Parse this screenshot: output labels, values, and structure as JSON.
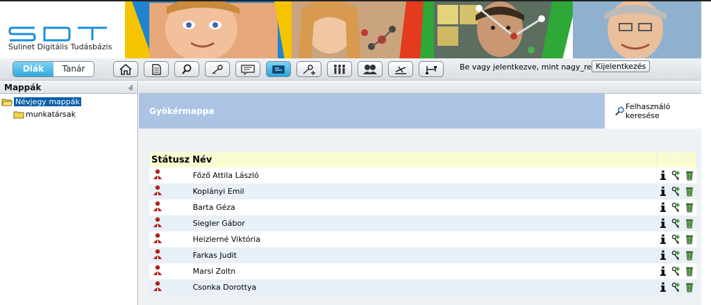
{
  "header": {
    "logo_mark": "SDT",
    "logo_tagline": "Sulinet Digitális Tudásbázis"
  },
  "toolbar": {
    "roles": [
      {
        "label": "Diák",
        "active": true
      },
      {
        "label": "Tanár",
        "active": false
      }
    ],
    "buttons": [
      {
        "icon": "home-icon",
        "active": false
      },
      {
        "icon": "document-icon",
        "active": false
      },
      {
        "icon": "search-icon",
        "active": false
      },
      {
        "icon": "key-icon",
        "active": false
      },
      {
        "icon": "message-icon",
        "active": false
      },
      {
        "icon": "business-card-icon",
        "active": true
      },
      {
        "icon": "add-key-icon",
        "active": false
      },
      {
        "icon": "group-icon",
        "active": false
      },
      {
        "icon": "users-icon",
        "active": false
      },
      {
        "icon": "tools-icon",
        "active": false
      },
      {
        "icon": "network-icon",
        "active": false
      }
    ],
    "login_status": "Be vagy jelentkezve, mint nagy_regina",
    "logout_label": "Kijelentkezés"
  },
  "left_panel": {
    "title": "Mappák",
    "tree": [
      {
        "label": "Névjegy mappák",
        "selected": true,
        "level": 0
      },
      {
        "label": "munkatársak",
        "selected": false,
        "level": 1
      }
    ]
  },
  "main": {
    "folder_title": "Gyökérmappa",
    "search_user_label": "Felhasználó keresése",
    "table": {
      "headers": {
        "status": "Státusz",
        "name": "Név"
      },
      "rows": [
        {
          "name": "Főző Attila László"
        },
        {
          "name": "Koplányi Emil"
        },
        {
          "name": "Barta Géza"
        },
        {
          "name": "Siegler Gábor"
        },
        {
          "name": "Heizlerné Viktória"
        },
        {
          "name": "Farkas Judit"
        },
        {
          "name": "Marsi Zoltn"
        },
        {
          "name": "Csonka Dorottya"
        }
      ]
    }
  },
  "colors": {
    "accent": "#2fa9df",
    "title_bar": "#abc4e4",
    "row_alt": "#e9f0f7",
    "header_row": "#fbfbd2"
  }
}
